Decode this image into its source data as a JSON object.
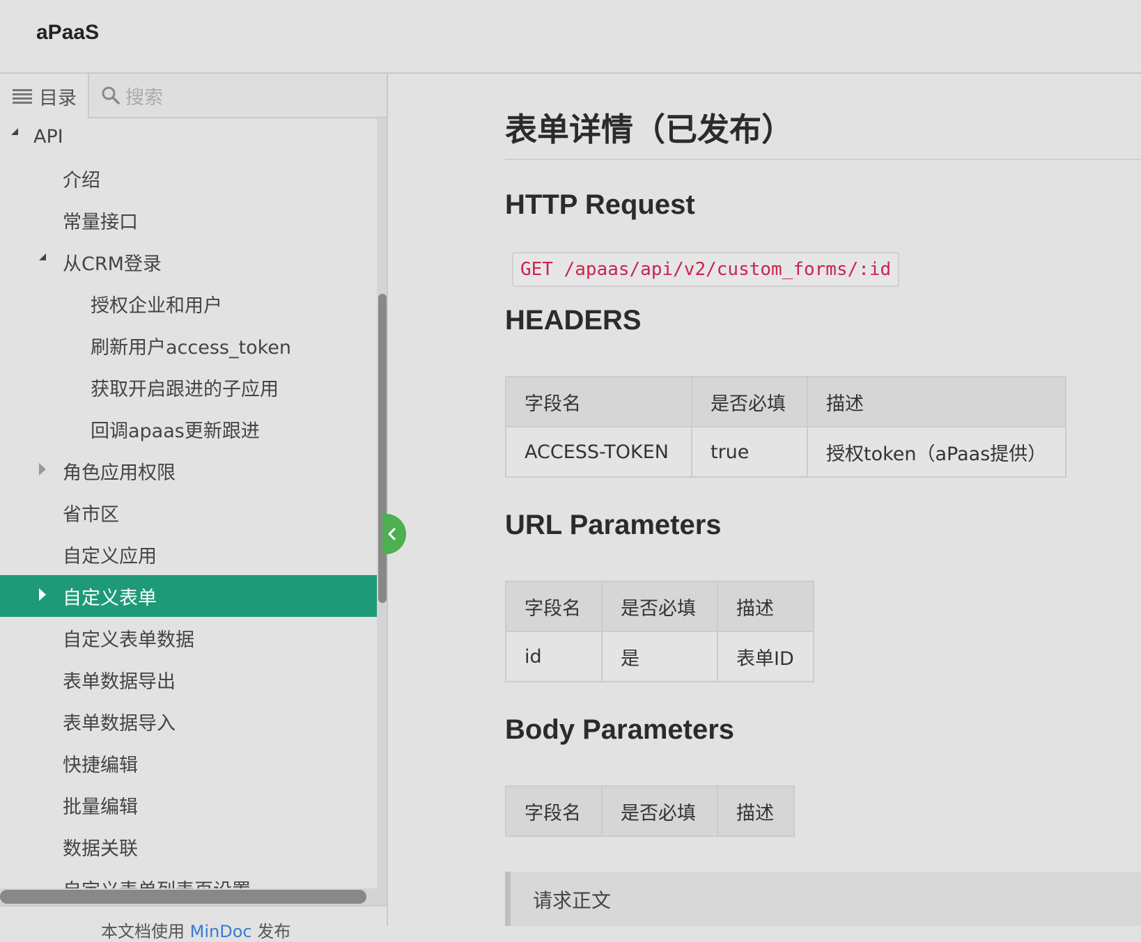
{
  "app": {
    "title": "aPaaS"
  },
  "sidebar": {
    "tabs": {
      "toc_label": "目录",
      "search_placeholder": "搜索"
    },
    "items": [
      {
        "label": "API",
        "level": 0,
        "state": "expanded"
      },
      {
        "label": "介绍",
        "level": 1,
        "state": "leaf"
      },
      {
        "label": "常量接口",
        "level": 1,
        "state": "leaf"
      },
      {
        "label": "从CRM登录",
        "level": 1,
        "state": "expanded"
      },
      {
        "label": "授权企业和用户",
        "level": 2,
        "state": "leaf"
      },
      {
        "label": "刷新用户access_token",
        "level": 2,
        "state": "leaf"
      },
      {
        "label": "获取开启跟进的子应用",
        "level": 2,
        "state": "leaf"
      },
      {
        "label": "回调apaas更新跟进",
        "level": 2,
        "state": "leaf"
      },
      {
        "label": "角色应用权限",
        "level": 1,
        "state": "collapsed"
      },
      {
        "label": "省市区",
        "level": 1,
        "state": "leaf"
      },
      {
        "label": "自定义应用",
        "level": 1,
        "state": "leaf"
      },
      {
        "label": "自定义表单",
        "level": 1,
        "state": "collapsed",
        "active": true
      },
      {
        "label": "自定义表单数据",
        "level": 1,
        "state": "leaf"
      },
      {
        "label": "表单数据导出",
        "level": 1,
        "state": "leaf"
      },
      {
        "label": "表单数据导入",
        "level": 1,
        "state": "leaf"
      },
      {
        "label": "快捷编辑",
        "level": 1,
        "state": "leaf"
      },
      {
        "label": "批量编辑",
        "level": 1,
        "state": "leaf"
      },
      {
        "label": "数据关联",
        "level": 1,
        "state": "leaf"
      },
      {
        "label": "自定义表单列表页设置",
        "level": 1,
        "state": "leaf"
      }
    ],
    "footer": {
      "prefix": "本文档使用 ",
      "link": "MinDoc",
      "suffix": " 发布"
    }
  },
  "content": {
    "title": "表单详情（已发布）",
    "http_request": {
      "heading": "HTTP Request",
      "code": "GET /apaas/api/v2/custom_forms/:id"
    },
    "headers": {
      "heading": "HEADERS",
      "columns": [
        "字段名",
        "是否必填",
        "描述"
      ],
      "rows": [
        [
          "ACCESS-TOKEN",
          "true",
          "授权token（aPaas提供）"
        ]
      ]
    },
    "url_params": {
      "heading": "URL Parameters",
      "columns": [
        "字段名",
        "是否必填",
        "描述"
      ],
      "rows": [
        [
          "id",
          "是",
          "表单ID"
        ]
      ]
    },
    "body_params": {
      "heading": "Body Parameters",
      "columns": [
        "字段名",
        "是否必填",
        "描述"
      ],
      "rows": []
    },
    "quote": "请求正文"
  },
  "colors": {
    "active": "#1f9a78",
    "toggle": "#4caf50",
    "code": "#c7254e",
    "link": "#3a7bd5"
  }
}
